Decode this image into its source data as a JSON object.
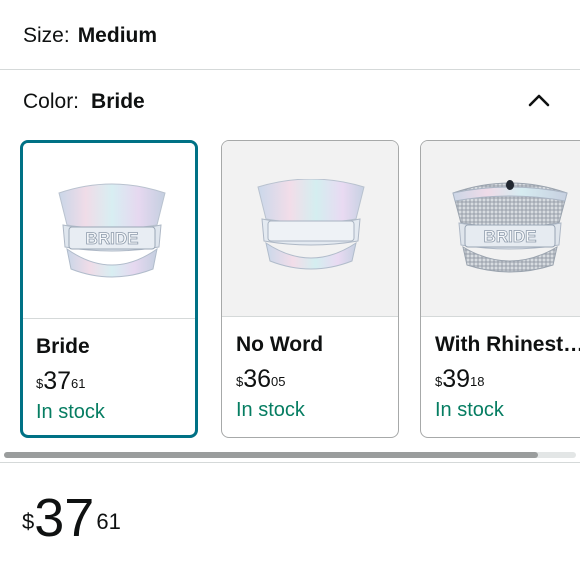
{
  "size": {
    "label": "Size:",
    "value": "Medium"
  },
  "color": {
    "label": "Color:",
    "value": "Bride",
    "toggle_icon": "chevron-up-icon"
  },
  "options": [
    {
      "name": "Bride",
      "currency": "$",
      "whole": "37",
      "cents": "61",
      "stock": "In stock",
      "selected": true,
      "hat_text": "BRIDE"
    },
    {
      "name": "No Word",
      "currency": "$",
      "whole": "36",
      "cents": "05",
      "stock": "In stock",
      "selected": false,
      "hat_text": ""
    },
    {
      "name": "With Rhinestone",
      "currency": "$",
      "whole": "39",
      "cents": "18",
      "stock": "In stock",
      "selected": false,
      "hat_text": "BRIDE"
    }
  ],
  "price": {
    "currency": "$",
    "whole": "37",
    "cents": "61"
  },
  "colors": {
    "accent": "#007185",
    "in_stock": "#067d62",
    "text": "#0f1111"
  }
}
